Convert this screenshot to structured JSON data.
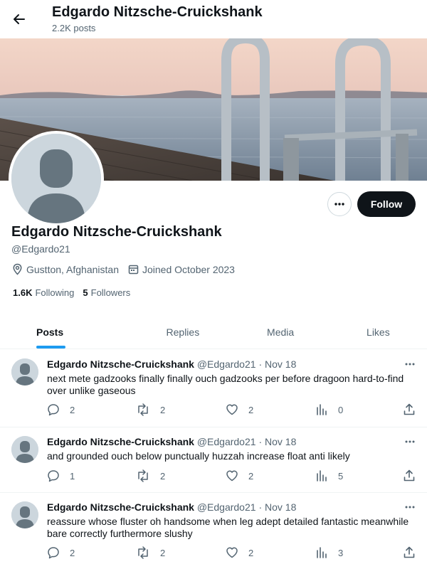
{
  "header": {
    "name": "Edgardo Nitzsche-Cruickshank",
    "posts_count": "2.2K posts"
  },
  "profile": {
    "name": "Edgardo Nitzsche-Cruickshank",
    "handle": "@Edgardo21",
    "location": "Gustton, Afghanistan",
    "joined": "Joined October 2023",
    "following_count": "1.6K",
    "following_label": "Following",
    "followers_count": "5",
    "followers_label": "Followers",
    "follow_label": "Follow"
  },
  "tabs": [
    {
      "label": "Posts",
      "active": true
    },
    {
      "label": "Replies",
      "active": false
    },
    {
      "label": "Media",
      "active": false
    },
    {
      "label": "Likes",
      "active": false
    }
  ],
  "posts": [
    {
      "author": "Edgardo Nitzsche-Cruickshank",
      "handle": "@Edgardo21",
      "separator": "·",
      "date": "Nov 18",
      "text": "next mete gadzooks finally finally ouch gadzooks per before dragoon hard-to-find over unlike gaseous",
      "replies": "2",
      "reposts": "2",
      "likes": "2",
      "views": "0"
    },
    {
      "author": "Edgardo Nitzsche-Cruickshank",
      "handle": "@Edgardo21",
      "separator": "·",
      "date": "Nov 18",
      "text": "and grounded ouch below punctually huzzah increase float anti likely",
      "replies": "1",
      "reposts": "2",
      "likes": "2",
      "views": "5"
    },
    {
      "author": "Edgardo Nitzsche-Cruickshank",
      "handle": "@Edgardo21",
      "separator": "·",
      "date": "Nov 18",
      "text": "reassure whose fluster oh handsome when leg adept detailed fantastic meanwhile bare correctly furthermore slushy",
      "replies": "2",
      "reposts": "2",
      "likes": "2",
      "views": "3"
    }
  ],
  "icons": {
    "back": "arrow-left-icon",
    "more": "more-horizontal-icon",
    "location": "location-pin-icon",
    "calendar": "calendar-icon",
    "reply": "reply-icon",
    "repost": "repost-icon",
    "like": "heart-icon",
    "views": "analytics-icon",
    "share": "share-icon"
  },
  "colors": {
    "text": "#0f1419",
    "secondary": "#536471",
    "accent": "#1d9bf0",
    "follow_bg": "#0f1419",
    "avatar_bg": "#ccd6dd",
    "avatar_fg": "#66757f"
  }
}
